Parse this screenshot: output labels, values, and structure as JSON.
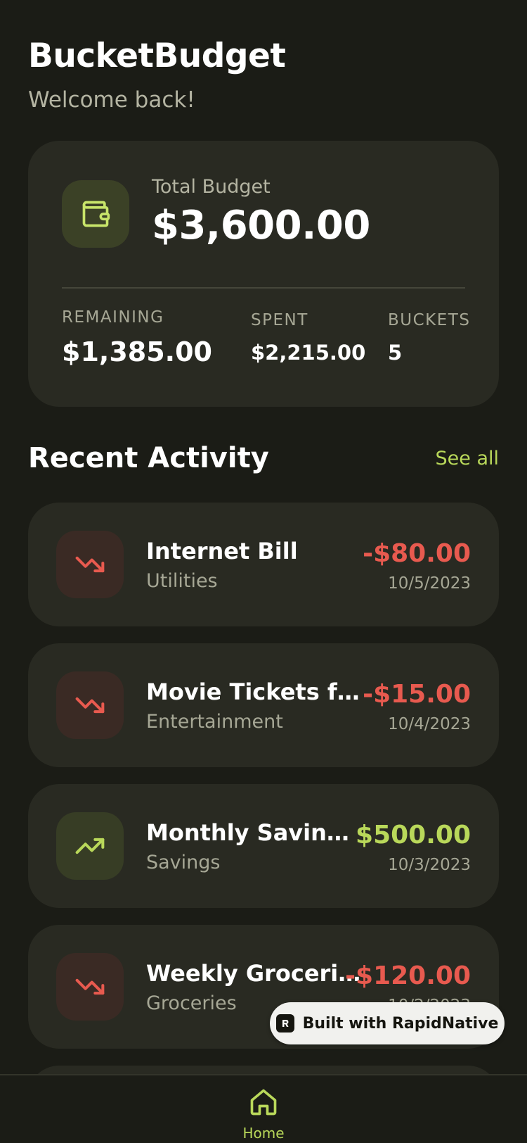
{
  "app": {
    "title": "BucketBudget",
    "welcome": "Welcome back!"
  },
  "budget": {
    "icon": "wallet-icon",
    "total_label": "Total Budget",
    "total_value": "$3,600.00",
    "remaining_label": "REMAINING",
    "remaining_value": "$1,385.00",
    "spent_label": "SPENT",
    "spent_value": "$2,215.00",
    "buckets_label": "BUCKETS",
    "buckets_value": "5"
  },
  "activity": {
    "title": "Recent Activity",
    "see_all": "See all",
    "items": [
      {
        "title": "Internet Bill",
        "category": "Utilities",
        "amount": "-$80.00",
        "date": "10/5/2023",
        "direction": "down",
        "icon": "trending-down-icon"
      },
      {
        "title": "Movie Tickets for Family",
        "category": "Entertainment",
        "amount": "-$15.00",
        "date": "10/4/2023",
        "direction": "down",
        "icon": "trending-down-icon"
      },
      {
        "title": "Monthly Savings Transfer",
        "category": "Savings",
        "amount": "$500.00",
        "date": "10/3/2023",
        "direction": "up",
        "icon": "trending-up-icon"
      },
      {
        "title": "Weekly Groceries",
        "category": "Groceries",
        "amount": "-$120.00",
        "date": "10/2/2023",
        "direction": "down",
        "icon": "trending-down-icon"
      }
    ]
  },
  "badge": {
    "text": "Built with RapidNative",
    "icon": "rapidnative-logo-icon"
  },
  "tabbar": {
    "home_label": "Home",
    "home_icon": "home-icon"
  },
  "colors": {
    "background": "#1b1c16",
    "card": "#292a22",
    "accent": "#b9d85a",
    "negative": "#e85a4f",
    "muted": "#a6a795"
  }
}
